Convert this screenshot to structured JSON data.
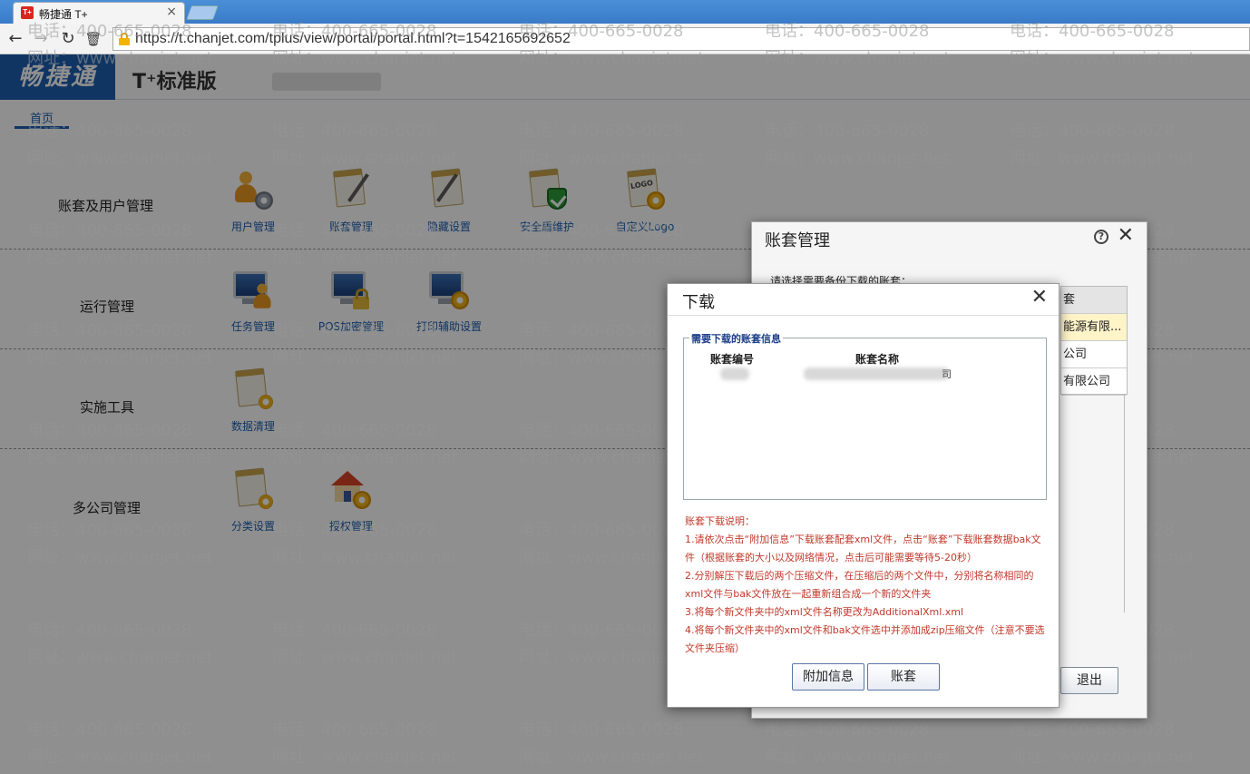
{
  "browser": {
    "tab_title": "畅捷通 T+",
    "tab_close": "×",
    "url": "https://t.chanjet.com/tplus/view/portal/portal.html?t=1542165692652",
    "favicon_text": "T+"
  },
  "app": {
    "brand": "畅捷通",
    "product": "T⁺标准版",
    "nav_home": "首页",
    "sections": [
      {
        "title": "账套及用户管理",
        "items": [
          {
            "label": "用户管理",
            "icon": "user-gear-icon"
          },
          {
            "label": "账套管理",
            "icon": "document-tools-icon"
          },
          {
            "label": "隐藏设置",
            "icon": "document-pen-icon"
          },
          {
            "label": "安全盾维护",
            "icon": "document-shield-icon"
          },
          {
            "label": "自定义Logo",
            "icon": "logo-gear-icon",
            "logo_text": "LOGO"
          }
        ]
      },
      {
        "title": "运行管理",
        "items": [
          {
            "label": "任务管理",
            "icon": "monitor-user-icon"
          },
          {
            "label": "POS加密管理",
            "icon": "monitor-lock-icon"
          },
          {
            "label": "打印辅助设置",
            "icon": "monitor-gear-icon"
          }
        ]
      },
      {
        "title": "实施工具",
        "items": [
          {
            "label": "数据清理",
            "icon": "document-clean-icon"
          }
        ]
      },
      {
        "title": "多公司管理",
        "items": [
          {
            "label": "分类设置",
            "icon": "document-category-icon"
          },
          {
            "label": "授权管理",
            "icon": "house-gear-icon"
          }
        ]
      }
    ]
  },
  "watermark": {
    "phone": "电话：400-665-0028",
    "site": "网址：www.chanjet.net"
  },
  "account_dialog": {
    "title": "账套管理",
    "hint": "请选择需要备份下载的账套：",
    "help": "?",
    "close": "✕",
    "rows": [
      "套",
      "能源有限...",
      "公司",
      "有限公司"
    ],
    "quit_label": "退出"
  },
  "download_dialog": {
    "title": "下载",
    "close": "✕",
    "legend": "需要下载的账套信息",
    "col_code": "账套编号",
    "col_name": "账套名称",
    "name_tail": "司",
    "notes": [
      "账套下载说明：",
      "1.请依次点击“附加信息”下载账套配套xml文件，点击“账套”下载账套数据bak文件（根据账套的大小以及网络情况，点击后可能需要等待5-20秒）",
      "2.分别解压下载后的两个压缩文件，在压缩后的两个文件中，分别将名称相同的xml文件与bak文件放在一起重新组合成一个新的文件夹",
      "3.将每个新文件夹中的xml文件名称更改为AdditionalXml.xml",
      "4.将每个新文件夹中的xml文件和bak文件选中并添加成zip压缩文件（注意不要选文件夹压缩）"
    ],
    "btn_extra": "附加信息",
    "btn_account": "账套"
  }
}
